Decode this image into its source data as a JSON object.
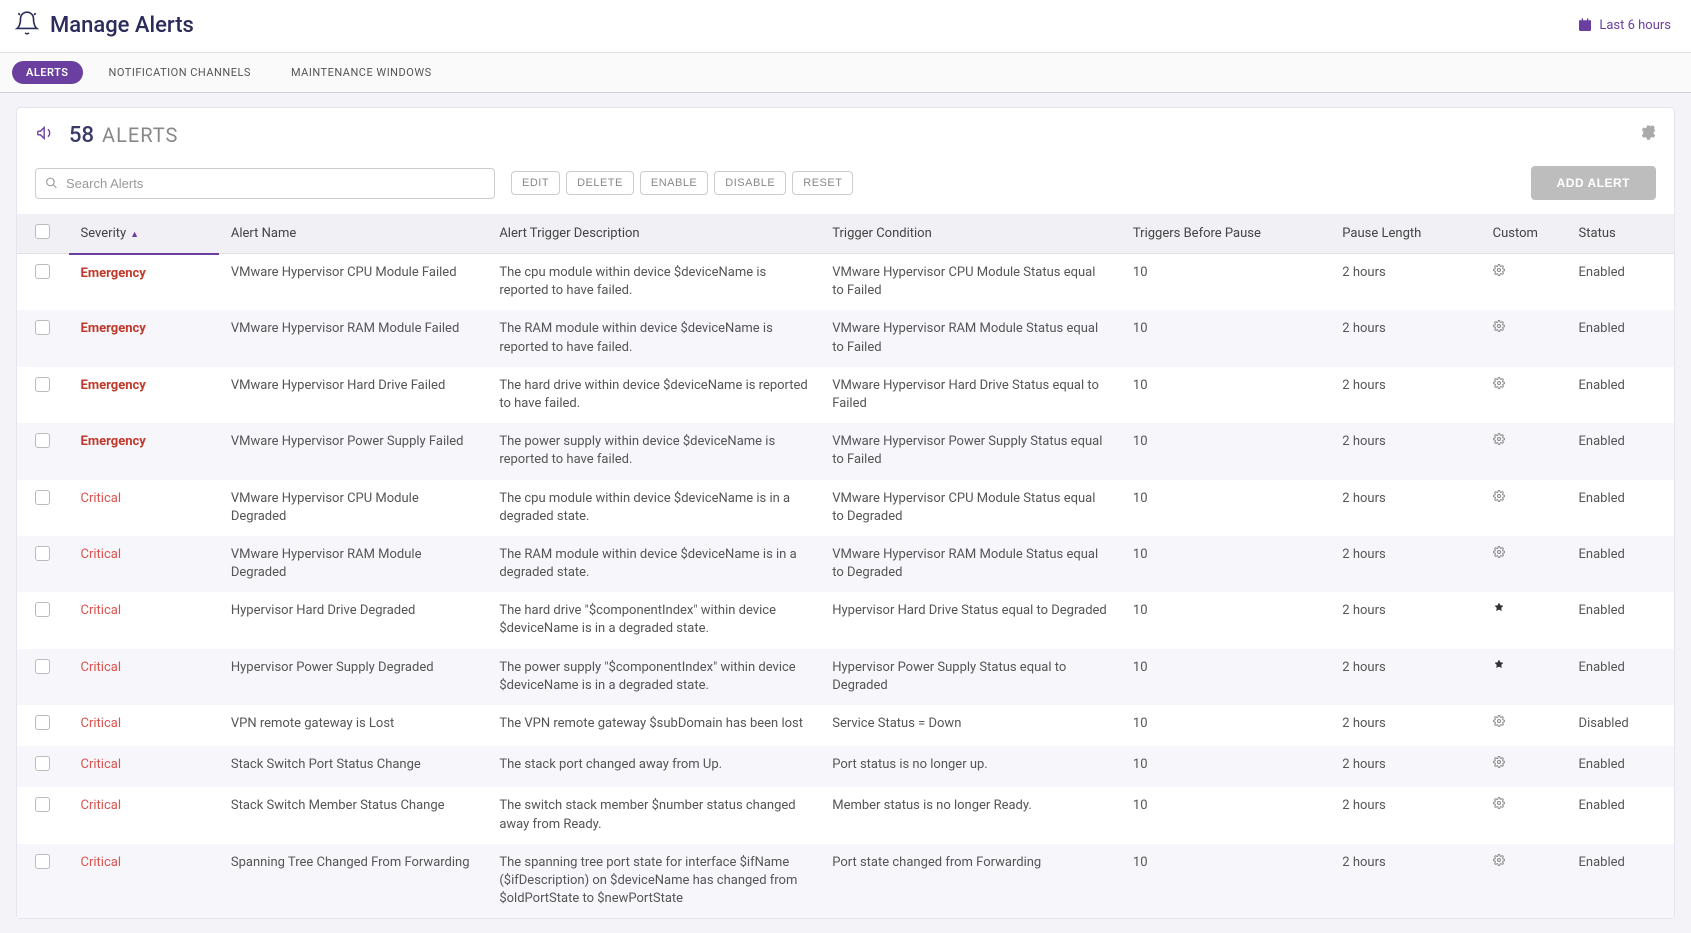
{
  "header": {
    "title": "Manage Alerts",
    "time_range": "Last 6 hours"
  },
  "tabs": [
    {
      "label": "ALERTS",
      "active": true
    },
    {
      "label": "NOTIFICATION CHANNELS",
      "active": false
    },
    {
      "label": "MAINTENANCE WINDOWS",
      "active": false
    }
  ],
  "alerts_summary": {
    "count": "58",
    "label": "ALERTS"
  },
  "search": {
    "placeholder": "Search Alerts"
  },
  "action_buttons": {
    "edit": "EDIT",
    "delete": "DELETE",
    "enable": "ENABLE",
    "disable": "DISABLE",
    "reset": "RESET",
    "add": "ADD ALERT"
  },
  "columns": {
    "severity": "Severity",
    "name": "Alert Name",
    "desc": "Alert Trigger Description",
    "cond": "Trigger Condition",
    "triggers": "Triggers Before Pause",
    "pause": "Pause Length",
    "custom": "Custom",
    "status": "Status"
  },
  "rows": [
    {
      "severity": "Emergency",
      "sev_class": "sev-emergency",
      "name": "VMware Hypervisor CPU Module Failed",
      "desc": "The cpu module within device $deviceName is reported to have failed.",
      "cond": "VMware Hypervisor CPU Module Status equal to Failed",
      "triggers": "10",
      "pause": "2 hours",
      "custom": "gear",
      "status": "Enabled"
    },
    {
      "severity": "Emergency",
      "sev_class": "sev-emergency",
      "name": "VMware Hypervisor RAM Module Failed",
      "desc": "The RAM module within device $deviceName is reported to have failed.",
      "cond": "VMware Hypervisor RAM Module Status equal to Failed",
      "triggers": "10",
      "pause": "2 hours",
      "custom": "gear",
      "status": "Enabled"
    },
    {
      "severity": "Emergency",
      "sev_class": "sev-emergency",
      "name": "VMware Hypervisor Hard Drive Failed",
      "desc": "The hard drive within device $deviceName is reported to have failed.",
      "cond": "VMware Hypervisor Hard Drive Status equal to Failed",
      "triggers": "10",
      "pause": "2 hours",
      "custom": "gear",
      "status": "Enabled"
    },
    {
      "severity": "Emergency",
      "sev_class": "sev-emergency",
      "name": "VMware Hypervisor Power Supply Failed",
      "desc": "The power supply within device $deviceName is reported to have failed.",
      "cond": "VMware Hypervisor Power Supply Status equal to Failed",
      "triggers": "10",
      "pause": "2 hours",
      "custom": "gear",
      "status": "Enabled"
    },
    {
      "severity": "Critical",
      "sev_class": "sev-critical",
      "name": "VMware Hypervisor CPU Module Degraded",
      "desc": "The cpu module within device $deviceName is in a degraded state.",
      "cond": "VMware Hypervisor CPU Module Status equal to Degraded",
      "triggers": "10",
      "pause": "2 hours",
      "custom": "gear",
      "status": "Enabled"
    },
    {
      "severity": "Critical",
      "sev_class": "sev-critical",
      "name": "VMware Hypervisor RAM Module Degraded",
      "desc": "The RAM module within device $deviceName is in a degraded state.",
      "cond": "VMware Hypervisor RAM Module Status equal to Degraded",
      "triggers": "10",
      "pause": "2 hours",
      "custom": "gear",
      "status": "Enabled"
    },
    {
      "severity": "Critical",
      "sev_class": "sev-critical",
      "name": "Hypervisor Hard Drive Degraded",
      "desc": "The hard drive \"$componentIndex\" within device $deviceName is in a degraded state.",
      "cond": "Hypervisor Hard Drive Status equal to Degraded",
      "triggers": "10",
      "pause": "2 hours",
      "custom": "star",
      "status": "Enabled"
    },
    {
      "severity": "Critical",
      "sev_class": "sev-critical",
      "name": "Hypervisor Power Supply Degraded",
      "desc": "The power supply \"$componentIndex\" within device $deviceName is in a degraded state.",
      "cond": "Hypervisor Power Supply Status equal to Degraded",
      "triggers": "10",
      "pause": "2 hours",
      "custom": "star",
      "status": "Enabled"
    },
    {
      "severity": "Critical",
      "sev_class": "sev-critical",
      "name": "VPN remote gateway is Lost",
      "desc": "The VPN remote gateway $subDomain has been lost",
      "cond": "Service Status = Down",
      "triggers": "10",
      "pause": "2 hours",
      "custom": "gear",
      "status": "Disabled"
    },
    {
      "severity": "Critical",
      "sev_class": "sev-critical",
      "name": "Stack Switch Port Status Change",
      "desc": "The stack port changed away from Up.",
      "cond": "Port status is no longer up.",
      "triggers": "10",
      "pause": "2 hours",
      "custom": "gear",
      "status": "Enabled"
    },
    {
      "severity": "Critical",
      "sev_class": "sev-critical",
      "name": "Stack Switch Member Status Change",
      "desc": "The switch stack member $number status changed away from Ready.",
      "cond": "Member status is no longer Ready.",
      "triggers": "10",
      "pause": "2 hours",
      "custom": "gear",
      "status": "Enabled"
    },
    {
      "severity": "Critical",
      "sev_class": "sev-critical",
      "name": "Spanning Tree Changed From Forwarding",
      "desc": "The spanning tree port state for interface $ifName ($ifDescription) on $deviceName has changed from $oldPortState to $newPortState",
      "cond": "Port state changed from Forwarding",
      "triggers": "10",
      "pause": "2 hours",
      "custom": "gear",
      "status": "Enabled"
    }
  ]
}
